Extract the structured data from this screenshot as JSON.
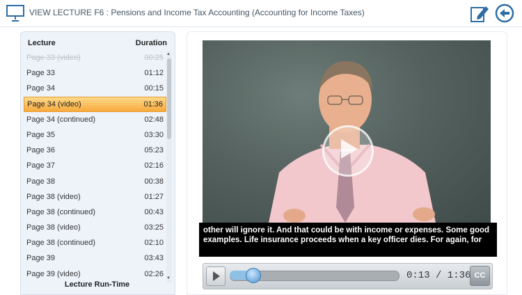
{
  "header": {
    "title": "VIEW LECTURE F6 : Pensions and Income Tax Accounting (Accounting for Income Taxes)"
  },
  "playlist": {
    "column_lecture": "Lecture",
    "column_duration": "Duration",
    "items": [
      {
        "label": "Page 33 (video)",
        "duration": "00:25",
        "state": "faded"
      },
      {
        "label": "Page 33",
        "duration": "01:12",
        "state": "normal"
      },
      {
        "label": "Page 34",
        "duration": "00:15",
        "state": "normal"
      },
      {
        "label": "Page 34 (video)",
        "duration": "01:36",
        "state": "selected"
      },
      {
        "label": "Page 34 (continued)",
        "duration": "02:48",
        "state": "normal"
      },
      {
        "label": "Page 35",
        "duration": "03:30",
        "state": "normal"
      },
      {
        "label": "Page 36",
        "duration": "05:23",
        "state": "normal"
      },
      {
        "label": "Page 37",
        "duration": "02:16",
        "state": "normal"
      },
      {
        "label": "Page 38",
        "duration": "00:38",
        "state": "normal"
      },
      {
        "label": "Page 38 (video)",
        "duration": "01:27",
        "state": "normal"
      },
      {
        "label": "Page 38 (continued)",
        "duration": "00:43",
        "state": "normal"
      },
      {
        "label": "Page 38 (video)",
        "duration": "03:25",
        "state": "normal"
      },
      {
        "label": "Page 38 (continued)",
        "duration": "02:10",
        "state": "normal"
      },
      {
        "label": "Page 39",
        "duration": "03:43",
        "state": "normal"
      },
      {
        "label": "Page 39 (video)",
        "duration": "02:26",
        "state": "normal"
      }
    ],
    "footer": "Lecture Run-Time"
  },
  "player": {
    "caption": "other will ignore it. And that could be with income or expenses. Some good examples. Life insurance proceeds when a key officer dies. For again, for",
    "time_display": "0:13 / 1:36",
    "progress": 0.135,
    "cc_label": "CC"
  },
  "colors": {
    "accent": "#2e6da4",
    "selected_row": "#f7a93c",
    "panel_bg": "#eef3fa"
  },
  "icons": {
    "header": "presentation-board-icon",
    "edit": "edit-note-icon",
    "back": "back-arrow-icon",
    "play": "play-icon"
  }
}
